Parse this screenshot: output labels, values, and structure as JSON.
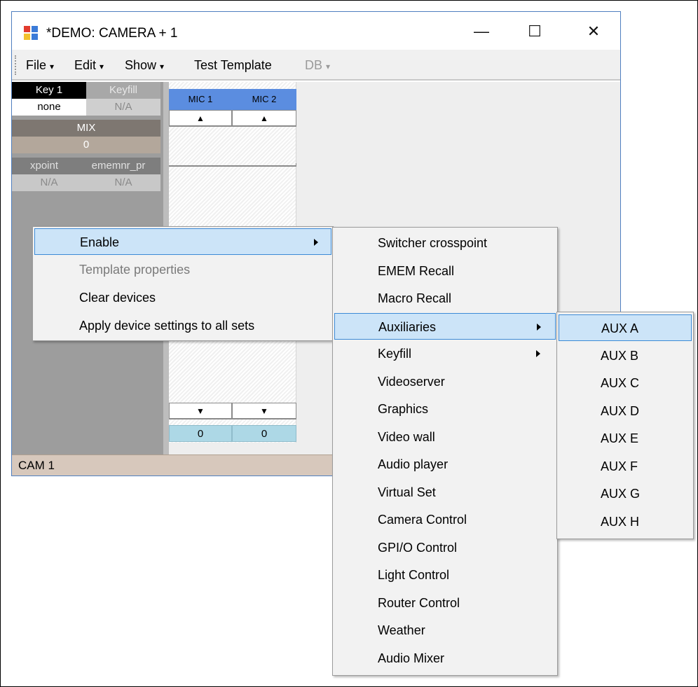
{
  "window": {
    "title": "*DEMO: CAMERA + 1"
  },
  "caption_buttons": {
    "minimize": "—",
    "maximize": "☐",
    "close": "✕"
  },
  "menubar": [
    {
      "label": "File",
      "caret": "▾"
    },
    {
      "label": "Edit",
      "caret": "▾"
    },
    {
      "label": "Show",
      "caret": "▾"
    },
    {
      "label": "Test Template",
      "caret": ""
    },
    {
      "label": "DB",
      "caret": "▾"
    }
  ],
  "left_panel": {
    "key_label": "Key 1",
    "keyfill_label": "Keyfill",
    "key_value": "none",
    "keyfill_value": "N/A",
    "mix_label": "MIX",
    "mix_value": "0",
    "xpoint_label": "xpoint",
    "ememnr_label": "ememnr_pr",
    "xpoint_value": "N/A",
    "ememnr_value": "N/A"
  },
  "mics": [
    {
      "label": "MIC 1",
      "up": "▲",
      "down": "▼",
      "value": "0"
    },
    {
      "label": "MIC 2",
      "up": "▲",
      "down": "▼",
      "value": "0"
    }
  ],
  "status_bar": {
    "text": "CAM 1"
  },
  "context_menu": [
    {
      "label": "Enable",
      "submenu": true,
      "highlighted": true,
      "enabled": true
    },
    {
      "label": "Template properties",
      "submenu": false,
      "highlighted": false,
      "enabled": false
    },
    {
      "label": "Clear devices",
      "submenu": false,
      "highlighted": false,
      "enabled": true
    },
    {
      "label": "Apply device settings to all sets",
      "submenu": false,
      "highlighted": false,
      "enabled": true
    }
  ],
  "enable_submenu": [
    {
      "label": "Switcher crosspoint"
    },
    {
      "label": "EMEM Recall"
    },
    {
      "label": "Macro Recall"
    },
    {
      "label": "Auxiliaries",
      "submenu": true,
      "highlighted": true
    },
    {
      "label": "Keyfill",
      "submenu": true
    },
    {
      "label": "Videoserver"
    },
    {
      "label": "Graphics"
    },
    {
      "label": "Video wall"
    },
    {
      "label": "Audio player"
    },
    {
      "label": "Virtual Set"
    },
    {
      "label": "Camera Control"
    },
    {
      "label": "GPI/O Control"
    },
    {
      "label": "Light Control"
    },
    {
      "label": "Router Control"
    },
    {
      "label": "Weather"
    },
    {
      "label": "Audio Mixer"
    }
  ],
  "aux_submenu": [
    {
      "label": "AUX A",
      "highlighted": true
    },
    {
      "label": "AUX B"
    },
    {
      "label": "AUX C"
    },
    {
      "label": "AUX D"
    },
    {
      "label": "AUX E"
    },
    {
      "label": "AUX F"
    },
    {
      "label": "AUX G"
    },
    {
      "label": "AUX H"
    }
  ],
  "colors": {
    "mic_header": "#5b8de0",
    "mic_value_bg": "#add8e6",
    "highlight_bg": "#cce4f8",
    "highlight_border": "#3c8ad6",
    "status_bar_bg": "#d7c8bc"
  }
}
